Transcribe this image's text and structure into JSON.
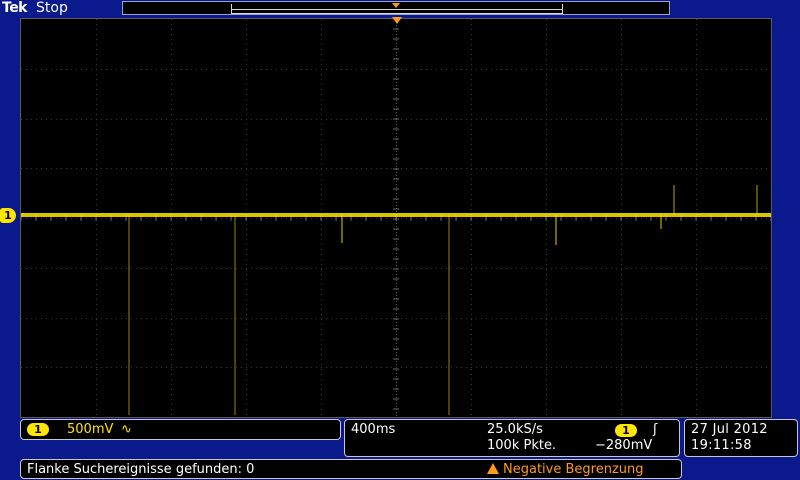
{
  "header": {
    "brand": "Tek",
    "status": "Stop"
  },
  "channel": {
    "number": "1",
    "scale": "500mV",
    "coupling": "∿",
    "color": "#ffe600"
  },
  "timebase": {
    "scale": "400ms",
    "sample_rate": "25.0kS/s",
    "record_length": "100k Pkte."
  },
  "trigger": {
    "source": "1",
    "slope": "ʃ",
    "level": "−280mV",
    "marker_color": "#ff9a1a"
  },
  "datetime": {
    "date": "27 Jul  2012",
    "time": "19:11:58"
  },
  "messages": {
    "search_result": "Flanke Suchereignisse gefunden: 0",
    "warning": "Negative Begrenzung"
  }
}
